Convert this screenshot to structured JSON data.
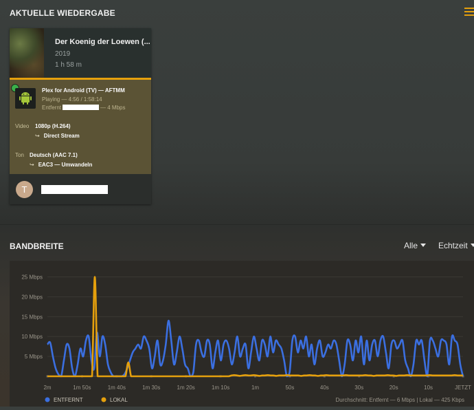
{
  "header": {
    "title": "AKTUELLE WIEDERGABE"
  },
  "session": {
    "title": "Der Koenig der Loewen (...",
    "year": "2019",
    "duration": "1 h 58 m",
    "player": "Plex for Android (TV)  —  AFTMM",
    "playing": "Playing — 4:56 / 1:58:14",
    "remote_prefix": "Entfernt",
    "remote_suffix": "— 4 Mbps",
    "video_label": "Video",
    "video_value": "1080p (H.264)",
    "video_stream": "Direct Stream",
    "audio_label": "Ton",
    "audio_value": "Deutsch (AAC 7.1)",
    "audio_stream": "EAC3 — Umwandeln",
    "user_initial": "T",
    "arrow": "↪"
  },
  "bandwidth": {
    "title": "BANDBREITE",
    "filter_all": "Alle",
    "filter_time": "Echtzeit",
    "footer_summary": "Durchschnitt: Entfernt — 6 Mbps | Lokal — 425 Kbps"
  },
  "colors": {
    "accent": "#e5a00d",
    "remote": "#3b6fe0",
    "local": "#e5a00d"
  },
  "chart_data": {
    "type": "line",
    "ylim": [
      0,
      27
    ],
    "y_ticks": [
      {
        "v": 5,
        "label": "5 Mbps"
      },
      {
        "v": 10,
        "label": "10 Mbps"
      },
      {
        "v": 15,
        "label": "15 Mbps"
      },
      {
        "v": 20,
        "label": "20 Mbps"
      },
      {
        "v": 25,
        "label": "25 Mbps"
      }
    ],
    "x_labels": [
      "2m",
      "1m 50s",
      "1m 40s",
      "1m 30s",
      "1m 20s",
      "1m 10s",
      "1m",
      "50s",
      "40s",
      "30s",
      "20s",
      "10s",
      "JETZT"
    ],
    "series": [
      {
        "name": "ENTFERNT",
        "color": "#3b6fe0",
        "values": [
          8,
          8.5,
          5,
          2,
          0.5,
          0,
          4,
          8,
          7,
          2,
          0,
          3,
          7,
          5,
          9,
          10,
          4,
          2,
          11,
          5,
          10,
          8,
          3,
          1,
          0,
          0,
          0,
          0,
          0.5,
          2,
          4,
          6,
          7,
          8,
          7,
          10,
          9,
          7,
          2,
          5,
          9,
          3,
          4,
          8,
          14,
          9,
          3,
          6,
          10,
          7,
          3,
          2,
          0,
          1,
          8,
          9,
          6,
          5,
          9,
          8,
          2,
          6,
          9,
          4,
          8,
          9,
          7,
          3,
          6,
          10,
          5,
          7,
          8,
          2,
          6,
          10,
          7,
          4,
          9,
          8,
          5,
          10,
          6,
          9,
          8,
          7,
          4,
          0,
          1,
          9,
          10,
          6,
          9,
          7,
          10,
          5,
          8,
          3,
          7,
          9,
          5,
          6,
          8,
          7,
          9,
          8,
          4,
          0,
          3,
          9,
          8,
          4,
          9,
          6,
          10,
          3,
          9,
          4,
          8,
          9,
          5,
          9,
          10,
          6,
          2,
          8,
          9,
          7,
          8,
          9,
          4,
          2,
          0,
          3,
          9,
          8,
          9,
          4,
          0,
          9,
          9,
          7,
          5,
          9,
          9,
          8,
          3,
          10,
          9,
          8,
          3,
          0
        ]
      },
      {
        "name": "LOKAL",
        "color": "#e5a00d",
        "values": [
          0,
          0,
          0,
          0,
          0,
          0,
          0,
          0,
          0,
          0,
          0,
          0,
          0,
          0,
          0,
          0,
          0,
          25,
          0,
          0,
          0,
          0,
          0,
          0,
          0,
          0,
          0,
          0,
          0,
          3.5,
          0,
          0,
          0,
          0,
          0,
          0,
          0,
          0,
          0,
          0,
          0,
          0,
          0,
          0,
          0,
          0,
          0,
          0,
          0,
          0,
          0,
          0,
          0,
          0,
          0,
          0,
          0,
          0,
          0,
          0,
          0,
          0,
          0,
          0,
          0,
          0,
          0.2,
          0.3,
          0.2,
          0.1,
          0.2,
          0.3,
          0.2,
          0.2,
          0.3,
          0.2,
          0.1,
          0.2,
          0.2,
          0.3,
          0.2,
          0.2,
          0.1,
          0.2,
          0.2,
          0.2,
          0.3,
          0.2,
          0.2,
          0.2,
          0.2,
          0.1,
          0.2,
          0.2,
          0.3,
          0.2,
          0.2,
          0.1,
          0.2,
          0.2,
          0.3,
          0.2,
          0.2,
          0.2,
          0.2,
          0.2,
          0.2,
          0.3,
          0.2,
          0.2,
          0.2,
          0.2,
          0.2,
          0.2,
          0.3,
          0.2,
          0.2,
          0.1,
          0.2,
          0.2,
          0.2,
          0.2,
          0.3,
          0.2,
          0.2,
          0.1,
          0.2,
          0.2,
          0.2,
          0.3,
          0.2,
          0.2,
          0.2,
          0.2,
          0.2,
          0.2,
          0.2,
          0.3,
          0.2,
          0.2,
          0.2,
          0.2,
          0.2,
          0.2,
          0.2,
          0.2,
          0.3,
          0.2,
          0.2,
          0.2
        ]
      }
    ]
  }
}
